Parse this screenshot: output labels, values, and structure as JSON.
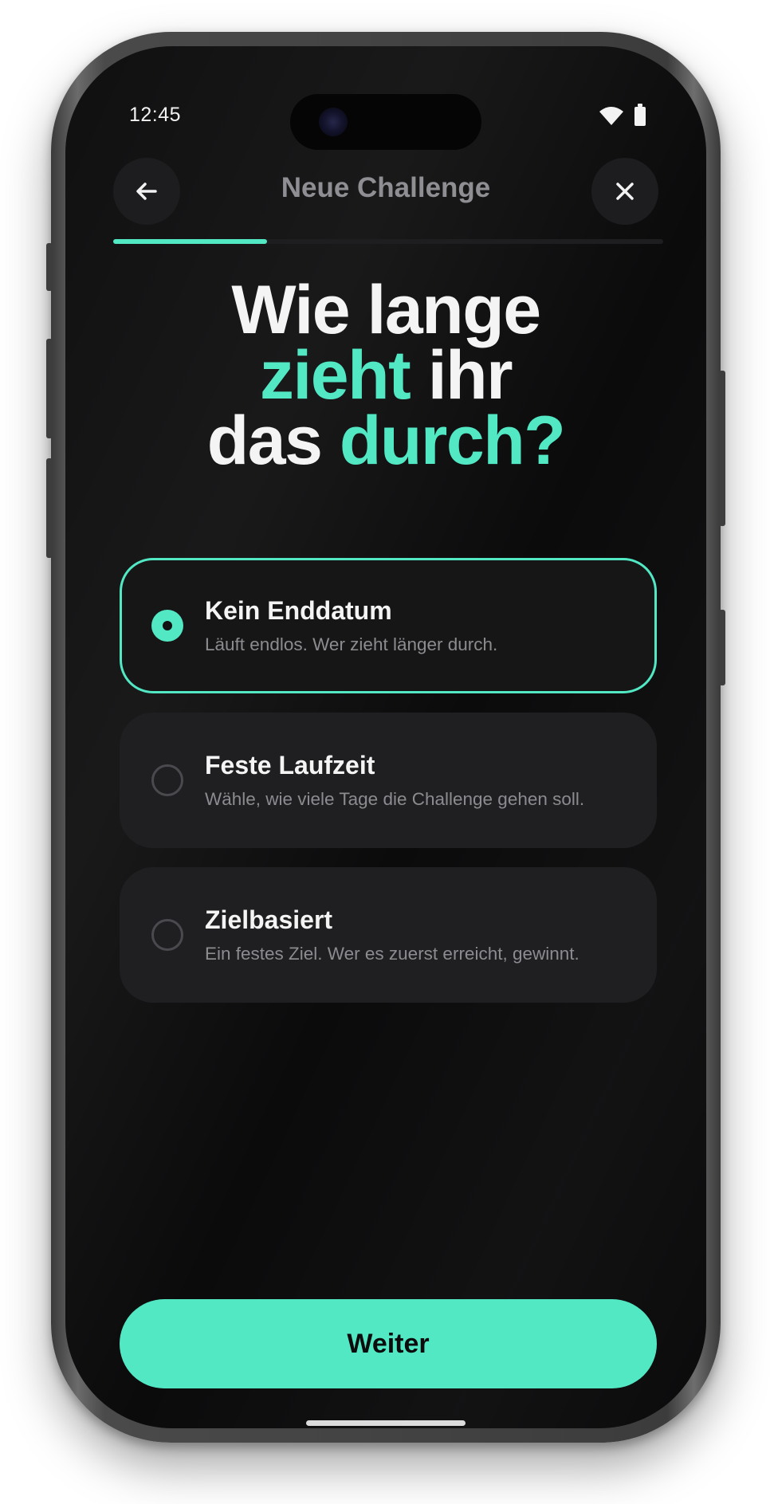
{
  "status_bar": {
    "time": "12:45"
  },
  "header": {
    "title": "Neue Challenge",
    "back_icon": "arrow-left-icon",
    "close_icon": "close-icon",
    "progress": 0.28
  },
  "headline": {
    "part1": "Wie lange",
    "accent1": "zieht",
    "part2": " ihr",
    "part3": "das ",
    "accent2": "durch?"
  },
  "options": [
    {
      "title": "Kein Enddatum",
      "description": "Läuft endlos. Wer zieht länger durch.",
      "selected": true
    },
    {
      "title": "Feste Laufzeit",
      "description": "Wähle, wie viele Tage die Challenge gehen soll.",
      "selected": false
    },
    {
      "title": "Zielbasiert",
      "description": "Ein festes Ziel. Wer es zuerst erreicht, gewinnt.",
      "selected": false
    }
  ],
  "cta": {
    "label": "Weiter"
  },
  "colors": {
    "accent": "#52e8c4",
    "background": "#0b0b0c",
    "card": "#1f1f22"
  }
}
